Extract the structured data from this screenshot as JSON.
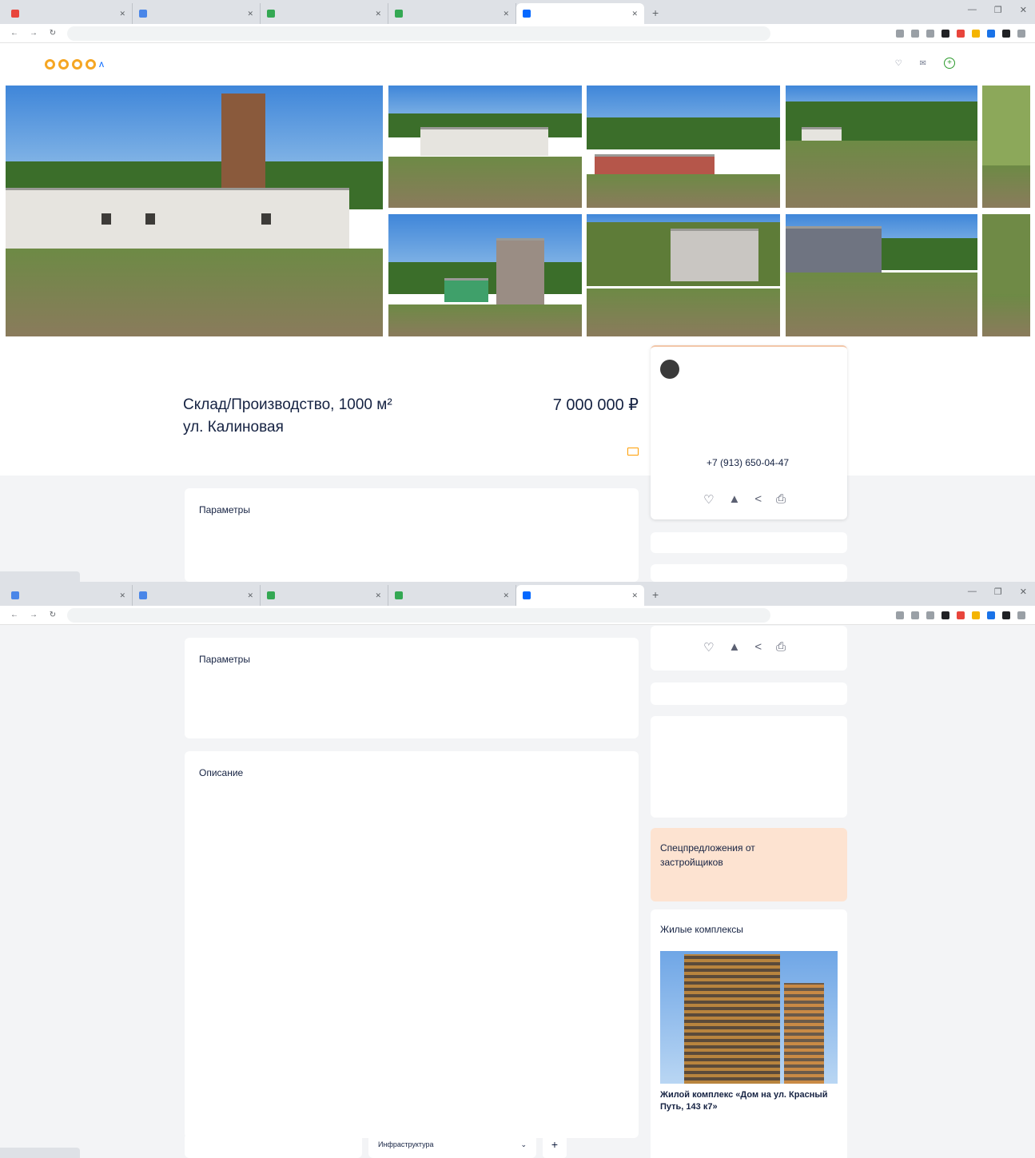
{
  "listing": {
    "title": "Склад/Производство, 1000 м²",
    "address": "ул. Калиновая",
    "price": "7 000 000 ₽",
    "agent_phone": "+7 (913) 650-04-47"
  },
  "params_title": "Параметры",
  "description_title": "Описание",
  "special_offers": "Спецпредложения от застройщиков",
  "complexes": {
    "title": "Жилые комплексы",
    "name": "Жилой комплекс «Дом на ул. Красный Путь, 143 к7»"
  },
  "map": {
    "infrastructure": "Инфраструктура"
  },
  "colors": {
    "brand_blue": "#0468ff",
    "accent_orange": "#ff9d00",
    "nav_green": "#2b9a2b",
    "special_bg": "#fde3d1"
  },
  "icons": {
    "favorite": "heart-icon",
    "complain": "warning-icon",
    "share": "share-icon",
    "print": "print-icon"
  }
}
